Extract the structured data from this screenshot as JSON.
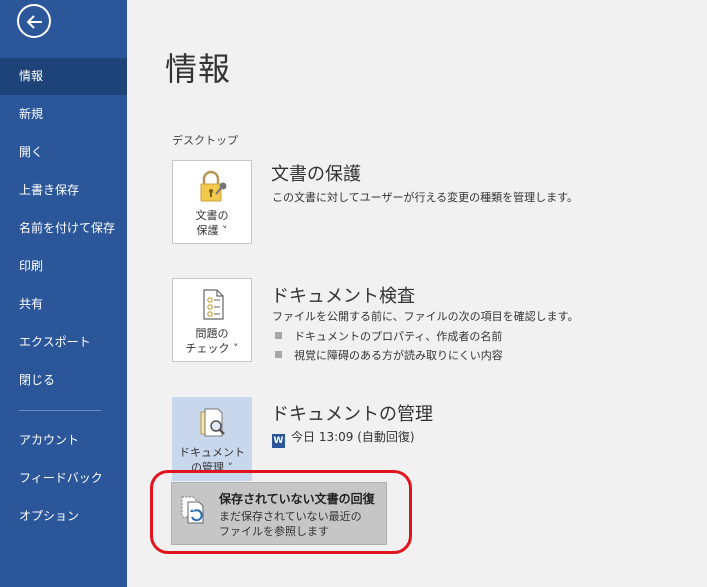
{
  "sidebar": {
    "back_label": "戻る",
    "items": [
      {
        "label": "情報"
      },
      {
        "label": "新規"
      },
      {
        "label": "開く"
      },
      {
        "label": "上書き保存"
      },
      {
        "label": "名前を付けて保存"
      },
      {
        "label": "印刷"
      },
      {
        "label": "共有"
      },
      {
        "label": "エクスポート"
      },
      {
        "label": "閉じる"
      },
      {
        "label": "アカウント"
      },
      {
        "label": "フィードバック"
      },
      {
        "label": "オプション"
      }
    ],
    "active": "情報",
    "bg_color": "#2b579a"
  },
  "main": {
    "title": "情報",
    "section_label": "デスクトップ",
    "protect": {
      "tile_label": "文書の\n保護 ˅",
      "title": "文書の保護",
      "desc": "この文書に対してユーザーが行える変更の種類を管理します。"
    },
    "inspect": {
      "tile_label": "問題の\nチェック ˅",
      "title": "ドキュメント検査",
      "desc": "ファイルを公開する前に、ファイルの次の項目を確認します。",
      "bullets": [
        "ドキュメントのプロパティ、作成者の名前",
        "視覚に障碍のある方が読み取りにくい内容"
      ]
    },
    "manage": {
      "tile_label": "ドキュメント\nの管理 ˅",
      "title": "ドキュメントの管理",
      "doc_icon": "W",
      "doc_entry": "今日 13:09 (自動回復)"
    },
    "dropdown": {
      "title": "保存されていない文書の回復",
      "desc": "まだ保存されていない最近の\nファイルを参照します"
    },
    "highlight_color": "#e0141e"
  }
}
